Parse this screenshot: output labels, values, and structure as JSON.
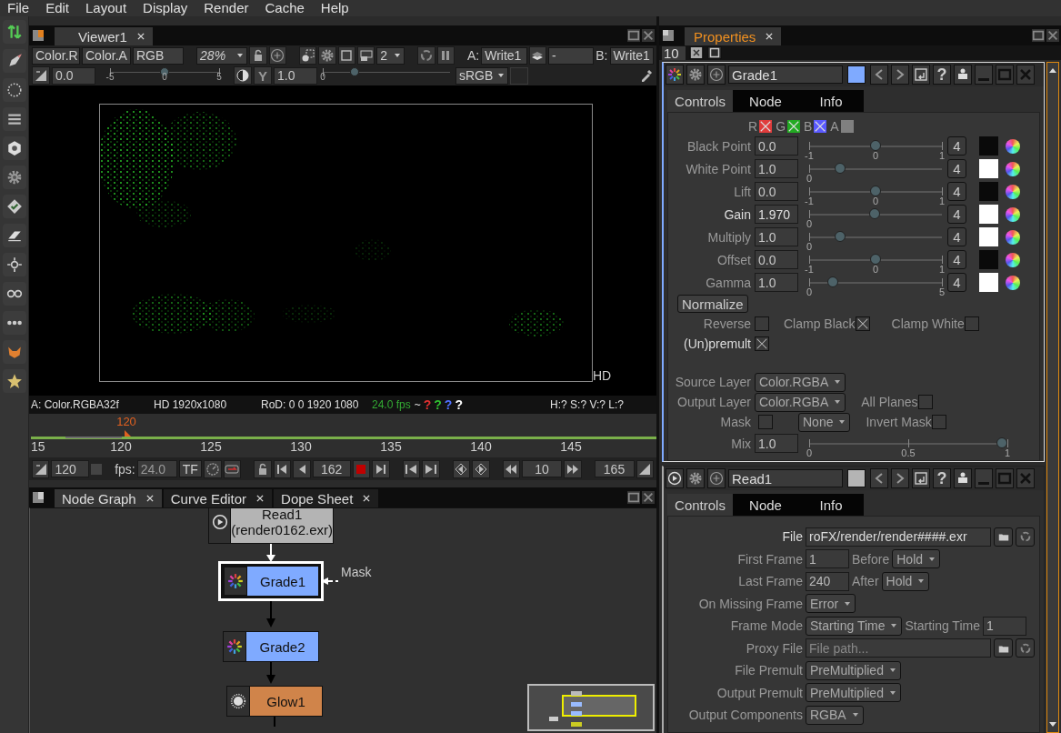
{
  "menu": [
    "File",
    "Edit",
    "Layout",
    "Display",
    "Render",
    "Cache",
    "Help"
  ],
  "viewer": {
    "tabs": [
      {
        "label": "Viewer1",
        "selected": true
      }
    ],
    "layer": "Color.R",
    "alpha_channel": "Color.A",
    "display_channels": "RGB",
    "zoom": "28%",
    "proxy_level": "2",
    "input_a": {
      "label": "A:",
      "value": "Write1"
    },
    "composite": "-",
    "input_b": {
      "label": "B:",
      "value": "Write1"
    },
    "gain": {
      "value": "0.0",
      "ticks": [
        "-5",
        "0",
        "5"
      ],
      "level": 0.5
    },
    "gamma_glyph": "Y",
    "gamma": {
      "value": "1.0",
      "ticks": [
        "0"
      ],
      "level": 0.25
    },
    "colorspace": "sRGB",
    "format_label": "HD",
    "info": {
      "channels": "A: Color.RGBA32f",
      "format": "HD 1920x1080",
      "rod": "RoD: 0 0 1920 1080",
      "fps": "24.0 fps",
      "tilde": "~",
      "pixel": [
        {
          "text": "?",
          "color": "#e03030"
        },
        {
          "text": "?",
          "color": "#30c030"
        },
        {
          "text": "?",
          "color": "#5070ff"
        },
        {
          "text": "?",
          "color": "#ffffff"
        }
      ],
      "hsvl": "H:? S:? V:? L:?"
    }
  },
  "timeline": {
    "cursor": "120",
    "ticks": [
      "15",
      "120",
      "125",
      "130",
      "135",
      "140",
      "145"
    ]
  },
  "playback": {
    "start_frame": "120",
    "fps_label": "fps:",
    "fps": "24.0",
    "turbo": "TF",
    "current_frame": "162",
    "increment": "10",
    "end_frame": "165"
  },
  "node_graph": {
    "tabs": [
      {
        "label": "Node Graph",
        "selected": true
      },
      {
        "label": "Curve Editor",
        "selected": false
      },
      {
        "label": "Dope Sheet",
        "selected": false
      }
    ],
    "nodes": [
      {
        "name": "Read1",
        "subtitle": "(render0162.exr)",
        "kind": "read",
        "selected": false,
        "color": "#b4b4b4"
      },
      {
        "name": "Grade1",
        "kind": "grade",
        "selected": true,
        "color": "#7faaff"
      },
      {
        "name": "Grade2",
        "kind": "grade",
        "selected": false,
        "color": "#7faaff"
      },
      {
        "name": "Glow1",
        "kind": "glow",
        "selected": false,
        "color": "#d0844a"
      }
    ],
    "mask_label": "Mask"
  },
  "properties": {
    "tabs": [
      {
        "label": "Properties",
        "selected": true
      }
    ],
    "max_panels": "10",
    "help_glyph": "?",
    "grade": {
      "name": "Grade1",
      "color": "#7faaff",
      "tabs": [
        {
          "label": "Controls",
          "selected": true
        },
        {
          "label": "Node",
          "selected": false
        },
        {
          "label": "Info",
          "selected": false
        }
      ],
      "channels": [
        {
          "label": "R",
          "checked": true,
          "color": "#e03c3c"
        },
        {
          "label": "G",
          "checked": true,
          "color": "#22aa22"
        },
        {
          "label": "B",
          "checked": true,
          "color": "#5a5aff"
        },
        {
          "label": "A",
          "checked": false,
          "color": "#808080"
        }
      ],
      "params": [
        {
          "label": "Black Point",
          "value": "0.0",
          "ticks": [
            "-1",
            "0",
            "1"
          ],
          "level": 0.5,
          "dims": "4",
          "modified": false,
          "color": "#0a0a0a"
        },
        {
          "label": "White Point",
          "value": "1.0",
          "ticks": [
            "0"
          ],
          "level": 0.23,
          "dims": "4",
          "modified": false,
          "color": "#ffffff"
        },
        {
          "label": "Lift",
          "value": "0.0",
          "ticks": [
            "-1",
            "0",
            "1"
          ],
          "level": 0.5,
          "dims": "4",
          "modified": false,
          "color": "#0a0a0a"
        },
        {
          "label": "Gain",
          "value": "1.970",
          "ticks": [
            "0"
          ],
          "level": 0.49,
          "dims": "4",
          "modified": true,
          "color": "#ffffff"
        },
        {
          "label": "Multiply",
          "value": "1.0",
          "ticks": [
            "0"
          ],
          "level": 0.23,
          "dims": "4",
          "modified": false,
          "color": "#ffffff"
        },
        {
          "label": "Offset",
          "value": "0.0",
          "ticks": [
            "-1",
            "0",
            "1"
          ],
          "level": 0.5,
          "dims": "4",
          "modified": false,
          "color": "#0a0a0a"
        },
        {
          "label": "Gamma",
          "value": "1.0",
          "ticks": [
            "0",
            "5"
          ],
          "level": 0.18,
          "dims": "4",
          "modified": false,
          "color": "#ffffff"
        }
      ],
      "normalize": "Normalize",
      "options": [
        {
          "label": "Reverse",
          "checked": false
        },
        {
          "label": "Clamp Black",
          "checked": true
        },
        {
          "label": "Clamp White",
          "checked": false
        }
      ],
      "unpremult": {
        "label": "(Un)premult",
        "checked": true
      },
      "source_layer": {
        "label": "Source Layer",
        "value": "Color.RGBA"
      },
      "output_layer": {
        "label": "Output Layer",
        "value": "Color.RGBA"
      },
      "all_planes": {
        "label": "All Planes",
        "checked": false
      },
      "mask": {
        "label": "Mask",
        "checked": false,
        "channel": "None"
      },
      "invert_mask": {
        "label": "Invert Mask",
        "checked": false
      },
      "mix": {
        "label": "Mix",
        "value": "1.0",
        "ticks": [
          "0",
          "0.5",
          "1"
        ],
        "level": 1
      }
    },
    "read": {
      "name": "Read1",
      "color": "#b4b4b4",
      "tabs": [
        {
          "label": "Controls",
          "selected": true
        },
        {
          "label": "Node",
          "selected": false
        },
        {
          "label": "Info",
          "selected": false
        }
      ],
      "rows": [
        {
          "kind": "file",
          "label": "File",
          "value": "roFX/render/render####.exr"
        },
        {
          "kind": "pair",
          "label": "First Frame",
          "value": "1",
          "extra_label": "Before",
          "extra_value": "Hold"
        },
        {
          "kind": "pair",
          "label": "Last Frame",
          "value": "240",
          "extra_label": "After",
          "extra_value": "Hold"
        },
        {
          "kind": "choice",
          "label": "On Missing Frame",
          "value": "Error"
        },
        {
          "kind": "choice_text",
          "label": "Frame Mode",
          "value": "Starting Time",
          "extra_label": "Starting Time",
          "extra_value": "1"
        },
        {
          "kind": "file",
          "label": "Proxy File",
          "placeholder": "File path..."
        },
        {
          "kind": "choice",
          "label": "File Premult",
          "value": "PreMultiplied"
        },
        {
          "kind": "choice",
          "label": "Output Premult",
          "value": "PreMultiplied"
        },
        {
          "kind": "choice",
          "label": "Output Components",
          "value": "RGBA"
        }
      ]
    }
  }
}
